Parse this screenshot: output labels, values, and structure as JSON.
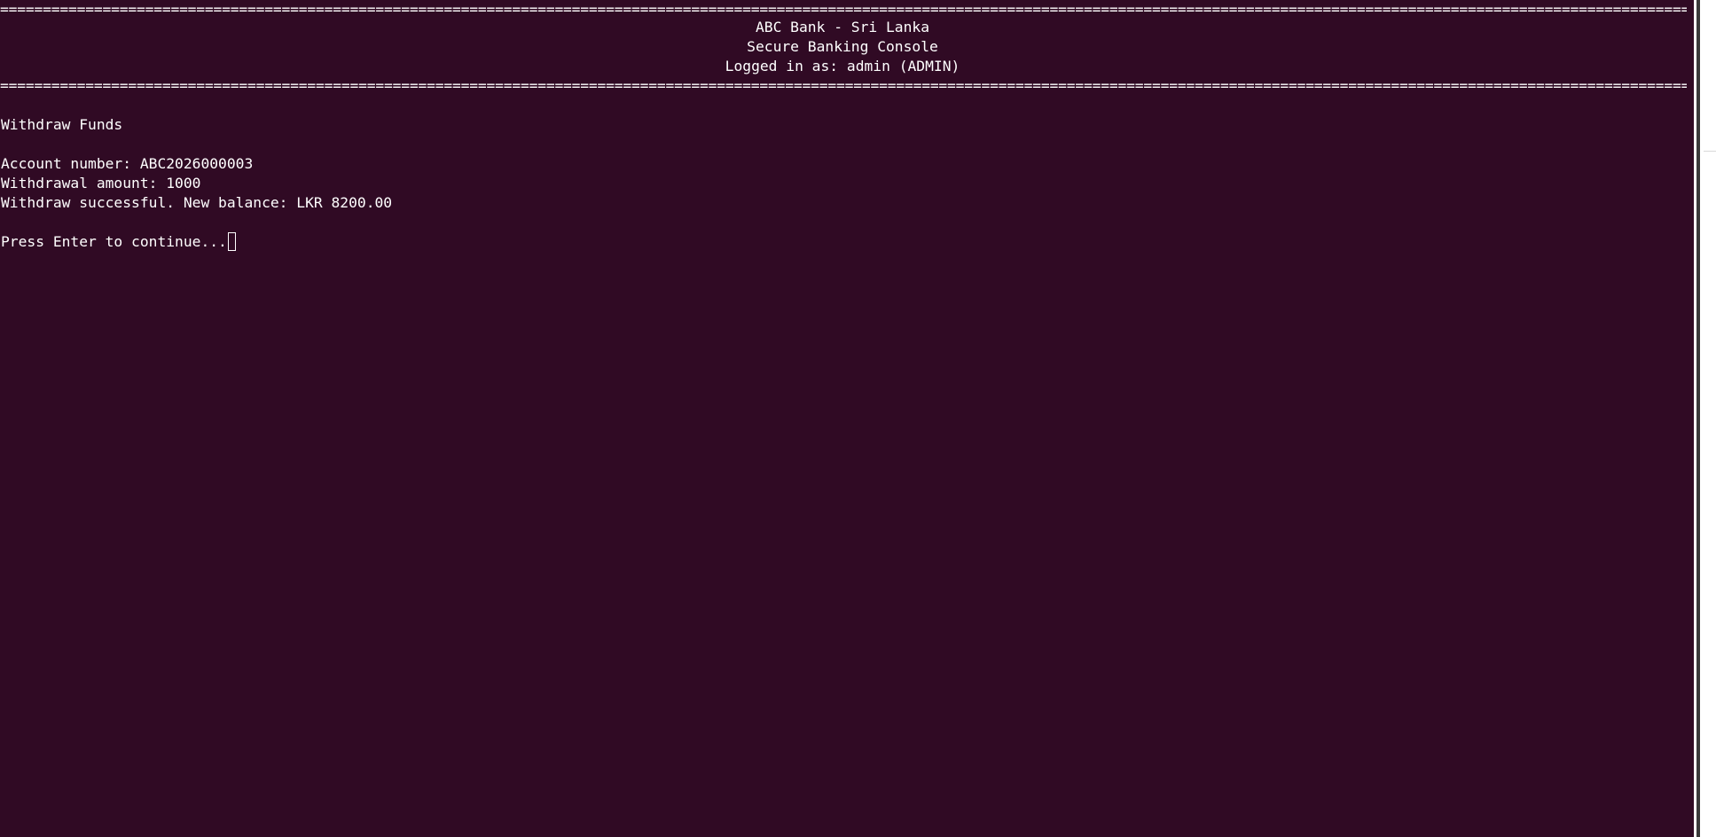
{
  "terminal": {
    "rule": "======================================================================================================================================================================================================================================================",
    "header": {
      "title": "ABC Bank - Sri Lanka",
      "subtitle": "Secure Banking Console",
      "login_status": "Logged in as: admin (ADMIN)"
    },
    "screen_title": "Withdraw Funds",
    "prompts": {
      "account_number": "Account number: ABC2026000003",
      "withdrawal_amount": "Withdrawal amount: 1000",
      "result": "Withdraw successful. New balance: LKR 8200.00",
      "continue": "Press Enter to continue..."
    }
  },
  "colors": {
    "background": "#300a24",
    "foreground": "#ffffff"
  }
}
